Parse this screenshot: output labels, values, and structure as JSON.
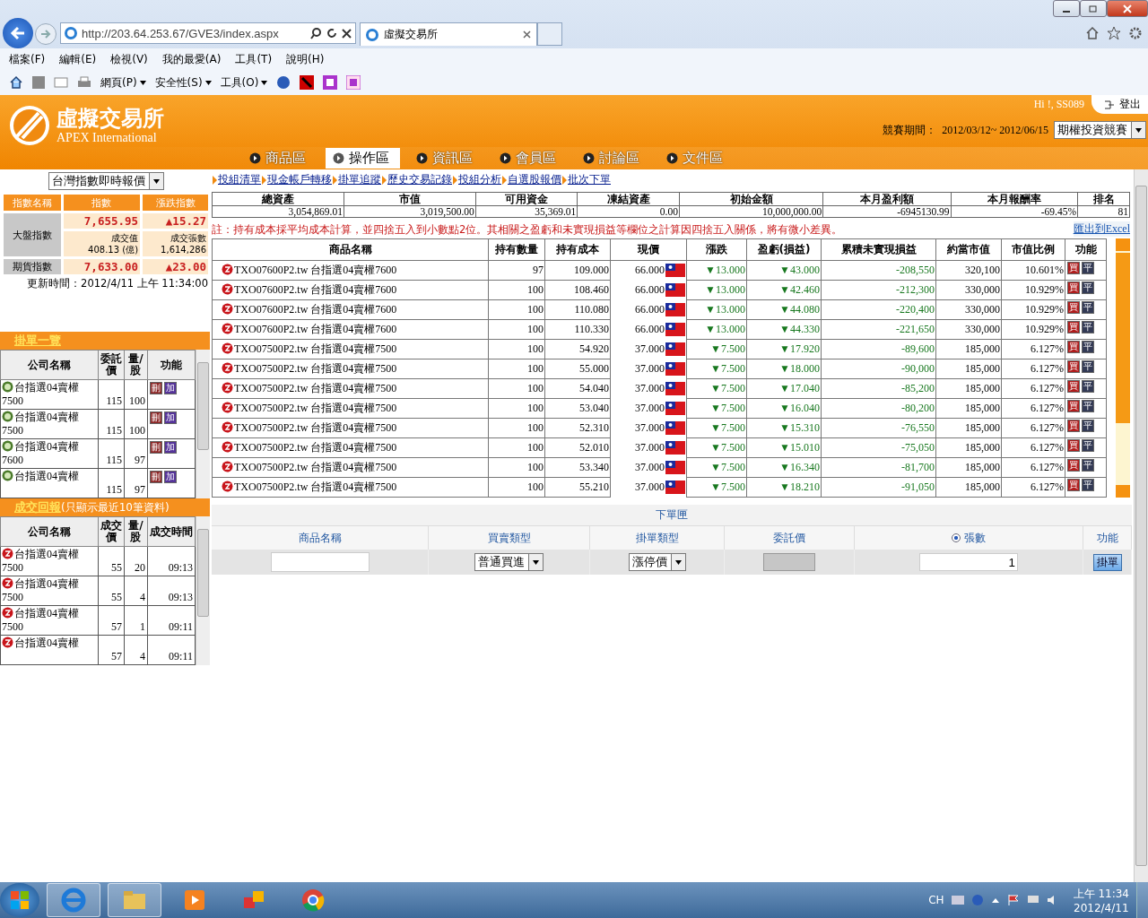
{
  "browser": {
    "url": "http://203.64.253.67/GVE3/index.aspx",
    "tab_title": "虛擬交易所",
    "menu": [
      "檔案(F)",
      "編輯(E)",
      "檢視(V)",
      "我的最愛(A)",
      "工具(T)",
      "說明(H)"
    ],
    "toolbar": [
      "網頁(P)",
      "安全性(S)",
      "工具(O)"
    ]
  },
  "header": {
    "logo_title": "虛擬交易所",
    "logo_subtitle": "APEX International",
    "greeting": "Hi !, SS089",
    "logout": "登出",
    "period_label": "競賽期間：",
    "period": "2012/03/12~ 2012/06/15",
    "contest": "期權投資競賽",
    "nav": [
      {
        "label": "商品區",
        "selected": false
      },
      {
        "label": "操作區",
        "selected": true
      },
      {
        "label": "資訊區",
        "selected": false
      },
      {
        "label": "會員區",
        "selected": false
      },
      {
        "label": "討論區",
        "selected": false
      },
      {
        "label": "文件區",
        "selected": false
      }
    ]
  },
  "index_panel": {
    "select": "台灣指數即時報價",
    "columns": [
      "指數名稱",
      "指數",
      "漲跌指數"
    ],
    "market_name": "大盤指數",
    "market_index": "7,655.95",
    "market_change": "▲15.27",
    "turnover_label": "成交值",
    "turnover": "408.13 (億)",
    "volume_label": "成交張數",
    "volume": "1,614,286",
    "futures_name": "期貨指數",
    "futures_index": "7,633.00",
    "futures_change": "▲23.00",
    "updated": "更新時間：2012/4/11 上午 11:34:00"
  },
  "pending": {
    "title": "掛單一覽",
    "columns": [
      "公司名稱",
      "委託價",
      "量/股",
      "功能"
    ],
    "rows": [
      {
        "name": "台指選04賣權",
        "sub": "7500",
        "price": "115",
        "qty": "100",
        "actions": [
          {
            "kind": "delete",
            "label": "刪"
          },
          {
            "kind": "add",
            "label": "加"
          }
        ]
      },
      {
        "name": "台指選04賣權",
        "sub": "7500",
        "price": "115",
        "qty": "100",
        "actions": [
          {
            "kind": "delete",
            "label": "刪"
          },
          {
            "kind": "add",
            "label": "加"
          }
        ]
      },
      {
        "name": "台指選04賣權",
        "sub": "7600",
        "price": "115",
        "qty": "97",
        "actions": [
          {
            "kind": "delete",
            "label": "刪"
          },
          {
            "kind": "add",
            "label": "加"
          }
        ]
      },
      {
        "name": "台指選04賣權",
        "price": "115",
        "qty": "97",
        "actions": [
          {
            "kind": "delete",
            "label": "刪"
          },
          {
            "kind": "add",
            "label": "加"
          }
        ]
      }
    ]
  },
  "fills": {
    "title": "成交回報",
    "note": "(只顯示最近10筆資料)",
    "columns": [
      "公司名稱",
      "成交價",
      "量/股",
      "成交時間"
    ],
    "rows": [
      {
        "name": "台指選04賣權",
        "sub": "7500",
        "price": "55",
        "qty": "20",
        "time": "09:13"
      },
      {
        "name": "台指選04賣權",
        "sub": "7500",
        "price": "55",
        "qty": "4",
        "time": "09:13"
      },
      {
        "name": "台指選04賣權",
        "sub": "7500",
        "price": "57",
        "qty": "1",
        "time": "09:11"
      },
      {
        "name": "台指選04賣權",
        "price": "57",
        "qty": "4",
        "time": "09:11"
      }
    ]
  },
  "links": [
    "投組清單",
    "現金帳戶轉移",
    "掛單追蹤",
    "歷史交易記錄",
    "投組分析",
    "自選股報價",
    "批次下單"
  ],
  "summary": {
    "columns": [
      "總資產",
      "市值",
      "可用資金",
      "凍結資產",
      "初始金額",
      "本月盈利額",
      "本月報酬率",
      "排名"
    ],
    "values": [
      "3,054,869.01",
      "3,019,500.00",
      "35,369.01",
      "0.00",
      "10,000,000.00",
      "-6945130.99",
      "-69.45%",
      "81"
    ]
  },
  "note": "註：持有成本採平均成本計算，並四捨五入到小數點2位。其相關之盈虧和未實現損益等欄位之計算因四捨五入關係，將有微小差異。",
  "export": "匯出到Excel",
  "holdings": {
    "columns": [
      "商品名稱",
      "持有數量",
      "持有成本",
      "現價",
      "漲跌",
      "盈虧(損益)",
      "累積未實現損益",
      "約當市值",
      "市值比例",
      "功能"
    ],
    "rows": [
      {
        "product": "TXO07600P2.tw 台指選04賣權7600",
        "qty": "97",
        "cost": "109.000",
        "price": "66.000",
        "change": "▼13.000",
        "pl": "▼43.000",
        "unrealized": "-208,550",
        "market": "320,100",
        "ratio": "10.601%",
        "actions": [
          {
            "kind": "buy",
            "label": "買"
          },
          {
            "kind": "close",
            "label": "平"
          }
        ]
      },
      {
        "product": "TXO07600P2.tw 台指選04賣權7600",
        "qty": "100",
        "cost": "108.460",
        "price": "66.000",
        "change": "▼13.000",
        "pl": "▼42.460",
        "unrealized": "-212,300",
        "market": "330,000",
        "ratio": "10.929%",
        "actions": [
          {
            "kind": "buy",
            "label": "買"
          },
          {
            "kind": "close",
            "label": "平"
          }
        ]
      },
      {
        "product": "TXO07600P2.tw 台指選04賣權7600",
        "qty": "100",
        "cost": "110.080",
        "price": "66.000",
        "change": "▼13.000",
        "pl": "▼44.080",
        "unrealized": "-220,400",
        "market": "330,000",
        "ratio": "10.929%",
        "actions": [
          {
            "kind": "buy",
            "label": "買"
          },
          {
            "kind": "close",
            "label": "平"
          }
        ]
      },
      {
        "product": "TXO07600P2.tw 台指選04賣權7600",
        "qty": "100",
        "cost": "110.330",
        "price": "66.000",
        "change": "▼13.000",
        "pl": "▼44.330",
        "unrealized": "-221,650",
        "market": "330,000",
        "ratio": "10.929%",
        "actions": [
          {
            "kind": "buy",
            "label": "買"
          },
          {
            "kind": "close",
            "label": "平"
          }
        ]
      },
      {
        "product": "TXO07500P2.tw 台指選04賣權7500",
        "qty": "100",
        "cost": "54.920",
        "price": "37.000",
        "change": "▼7.500",
        "pl": "▼17.920",
        "unrealized": "-89,600",
        "market": "185,000",
        "ratio": "6.127%",
        "actions": [
          {
            "kind": "buy",
            "label": "買"
          },
          {
            "kind": "close",
            "label": "平"
          }
        ]
      },
      {
        "product": "TXO07500P2.tw 台指選04賣權7500",
        "qty": "100",
        "cost": "55.000",
        "price": "37.000",
        "change": "▼7.500",
        "pl": "▼18.000",
        "unrealized": "-90,000",
        "market": "185,000",
        "ratio": "6.127%",
        "actions": [
          {
            "kind": "buy",
            "label": "買"
          },
          {
            "kind": "close",
            "label": "平"
          }
        ]
      },
      {
        "product": "TXO07500P2.tw 台指選04賣權7500",
        "qty": "100",
        "cost": "54.040",
        "price": "37.000",
        "change": "▼7.500",
        "pl": "▼17.040",
        "unrealized": "-85,200",
        "market": "185,000",
        "ratio": "6.127%",
        "actions": [
          {
            "kind": "buy",
            "label": "買"
          },
          {
            "kind": "close",
            "label": "平"
          }
        ]
      },
      {
        "product": "TXO07500P2.tw 台指選04賣權7500",
        "qty": "100",
        "cost": "53.040",
        "price": "37.000",
        "change": "▼7.500",
        "pl": "▼16.040",
        "unrealized": "-80,200",
        "market": "185,000",
        "ratio": "6.127%",
        "actions": [
          {
            "kind": "buy",
            "label": "買"
          },
          {
            "kind": "close",
            "label": "平"
          }
        ]
      },
      {
        "product": "TXO07500P2.tw 台指選04賣權7500",
        "qty": "100",
        "cost": "52.310",
        "price": "37.000",
        "change": "▼7.500",
        "pl": "▼15.310",
        "unrealized": "-76,550",
        "market": "185,000",
        "ratio": "6.127%",
        "actions": [
          {
            "kind": "buy",
            "label": "買"
          },
          {
            "kind": "close",
            "label": "平"
          }
        ]
      },
      {
        "product": "TXO07500P2.tw 台指選04賣權7500",
        "qty": "100",
        "cost": "52.010",
        "price": "37.000",
        "change": "▼7.500",
        "pl": "▼15.010",
        "unrealized": "-75,050",
        "market": "185,000",
        "ratio": "6.127%",
        "actions": [
          {
            "kind": "buy",
            "label": "買"
          },
          {
            "kind": "close",
            "label": "平"
          }
        ]
      },
      {
        "product": "TXO07500P2.tw 台指選04賣權7500",
        "qty": "100",
        "cost": "53.340",
        "price": "37.000",
        "change": "▼7.500",
        "pl": "▼16.340",
        "unrealized": "-81,700",
        "market": "185,000",
        "ratio": "6.127%",
        "actions": [
          {
            "kind": "buy",
            "label": "買"
          },
          {
            "kind": "close",
            "label": "平"
          }
        ]
      },
      {
        "product": "TXO07500P2.tw 台指選04賣權7500",
        "qty": "100",
        "cost": "55.210",
        "price": "37.000",
        "change": "▼7.500",
        "pl": "▼18.210",
        "unrealized": "-91,050",
        "market": "185,000",
        "ratio": "6.127%",
        "actions": [
          {
            "kind": "buy",
            "label": "買"
          },
          {
            "kind": "close",
            "label": "平"
          }
        ]
      }
    ]
  },
  "order_form": {
    "title": "下單匣",
    "columns": [
      "商品名稱",
      "買賣類型",
      "掛單類型",
      "委託價",
      "張數",
      "功能"
    ],
    "side": "普通買進",
    "order_type": "漲停價",
    "price_disabled": true,
    "qty_radio_selected": true,
    "qty": "1",
    "submit": "掛單"
  },
  "taskbar": {
    "ime": "CH",
    "time": "上午 11:34",
    "date": "2012/4/11"
  }
}
